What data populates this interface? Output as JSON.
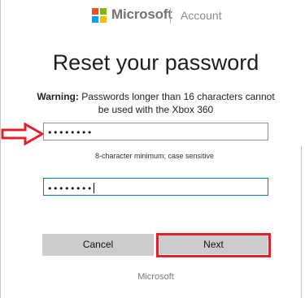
{
  "header": {
    "brand": "Microsoft",
    "section": "Account",
    "logo_colors": [
      "#f25022",
      "#7fba00",
      "#00a4ef",
      "#ffb900"
    ]
  },
  "page": {
    "title": "Reset your password",
    "warning_label": "Warning:",
    "warning_text": " Passwords longer than 16 characters cannot be used with the Xbox 360"
  },
  "form": {
    "new_password_value": "••••••••",
    "hint": "8-character minimum; case sensitive",
    "confirm_password_value": "••••••••"
  },
  "buttons": {
    "cancel_label": "Cancel",
    "next_label": "Next"
  },
  "footer": {
    "text": "Microsoft"
  },
  "annotations": {
    "arrow_color": "#e2212c",
    "highlight_color": "#e2212c"
  }
}
